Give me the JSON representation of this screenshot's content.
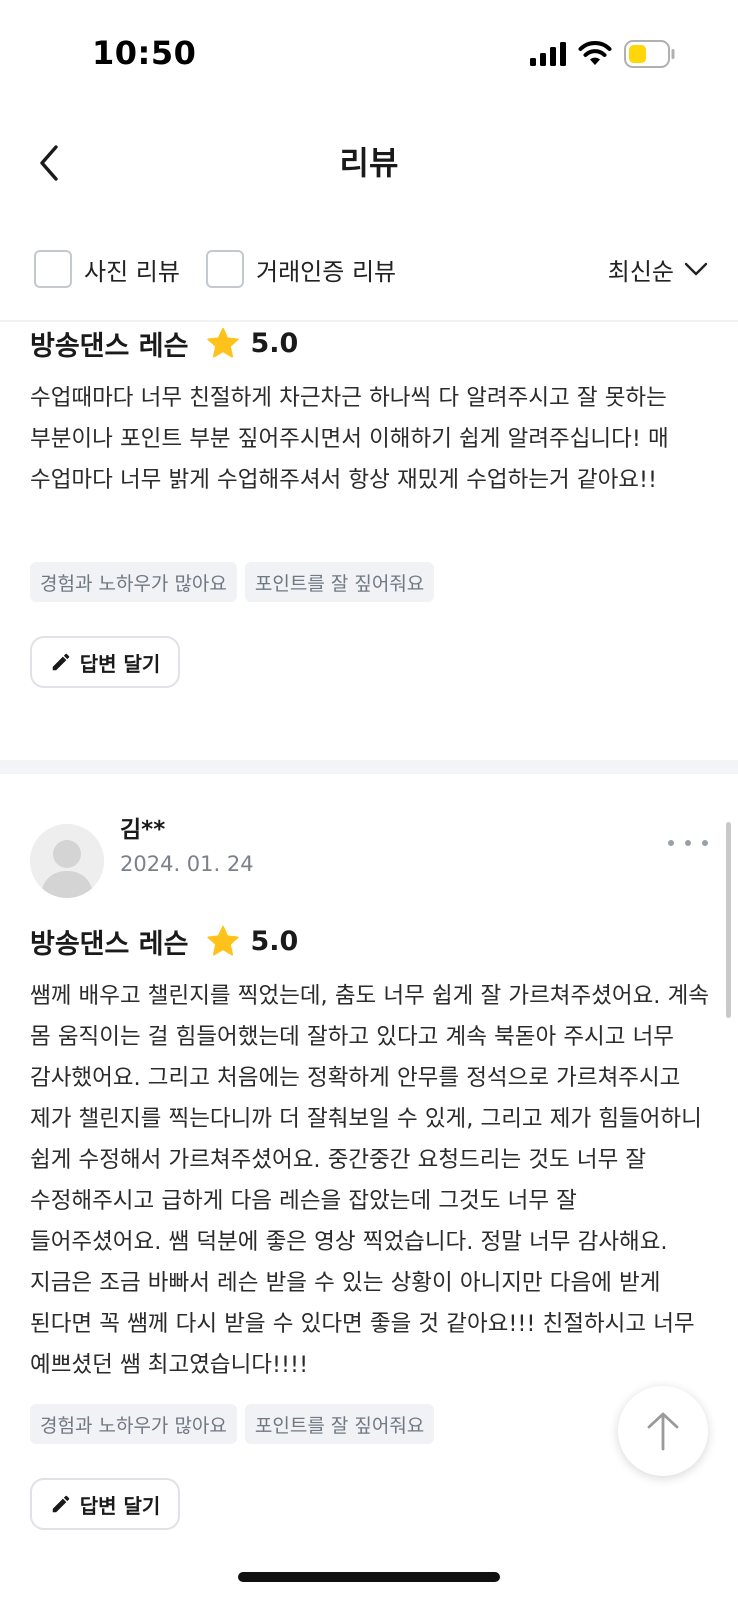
{
  "status_bar": {
    "time": "10:50"
  },
  "header": {
    "title": "리뷰"
  },
  "filters": {
    "photo_review": "사진 리뷰",
    "verified_review": "거래인증 리뷰",
    "sort": "최신순"
  },
  "reviews": [
    {
      "product": "방송댄스 레슨",
      "rating": "5.0",
      "text": "수업때마다 너무 친절하게 차근차근 하나씩 다 알려주시고 잘 못하는 부분이나 포인트 부분 짚어주시면서 이해하기 쉽게 알려주십니다! 매 수업마다 너무 밝게 수업해주셔서 항상 재밌게 수업하는거 같아요!!",
      "tags": [
        "경험과 노하우가 많아요",
        "포인트를 잘 짚어줘요"
      ],
      "reply_label": "답변 달기"
    },
    {
      "reviewer": "김**",
      "date": "2024. 01. 24",
      "product": "방송댄스 레슨",
      "rating": "5.0",
      "text": "쌤께 배우고 챌린지를 찍었는데, 춤도 너무 쉽게 잘 가르쳐주셨어요. 계속 몸 움직이는 걸 힘들어했는데 잘하고 있다고 계속 북돋아 주시고 너무 감사했어요. 그리고 처음에는 정확하게 안무를 정석으로 가르쳐주시고 제가 챌린지를 찍는다니까 더 잘춰보일 수 있게, 그리고 제가 힘들어하니 쉽게 수정해서 가르쳐주셨어요. 중간중간 요청드리는 것도 너무 잘 수정해주시고 급하게 다음 레슨을 잡았는데 그것도 너무 잘 들어주셨어요. 쌤 덕분에 좋은 영상 찍었습니다. 정말 너무 감사해요. 지금은 조금 바빠서 레슨 받을 수 있는 상황이 아니지만 다음에 받게 된다면 꼭 쌤께 다시 받을 수 있다면 좋을 것 같아요!!! 친절하시고 너무 예쁘셨던 쌤 최고였습니다!!!!",
      "tags": [
        "경험과 노하우가 많아요",
        "포인트를 잘 짚어줘요"
      ],
      "reply_label": "답변 달기"
    }
  ],
  "colors": {
    "star": "#FFC21A",
    "battery": "#FFD60A",
    "tag_bg": "#F0F2F5"
  },
  "icons": [
    "signal-icon",
    "wifi-icon",
    "battery-icon",
    "back-arrow-icon",
    "chevron-down-icon",
    "star-icon",
    "pencil-icon",
    "more-icon",
    "arrow-up-icon",
    "avatar-placeholder"
  ]
}
